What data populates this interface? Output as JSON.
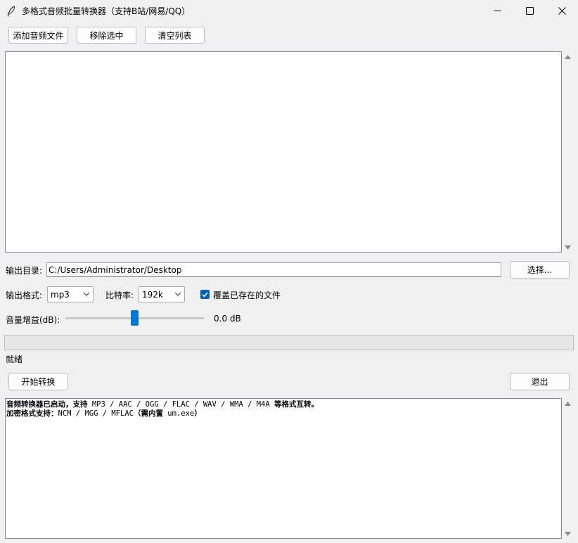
{
  "window": {
    "title": "多格式音频批量转换器（支持B站/网易/QQ）"
  },
  "toolbar": {
    "add_label": "添加音频文件",
    "remove_label": "移除选中",
    "clear_label": "清空列表"
  },
  "file_list": {
    "items": []
  },
  "output": {
    "dir_label": "输出目录:",
    "dir_value": "C:/Users/Administrator/Desktop",
    "choose_label": "选择..."
  },
  "format": {
    "label": "输出格式:",
    "value": "mp3",
    "bitrate_label": "比特率:",
    "bitrate_value": "192k",
    "overwrite_label": "覆盖已存在的文件",
    "overwrite_checked": true
  },
  "gain": {
    "label": "音量增益(dB):",
    "value_text": "0.0 dB",
    "slider_fraction": 0.5
  },
  "progress": {
    "fraction": 0
  },
  "status": {
    "text": "就绪"
  },
  "actions": {
    "start_label": "开始转换",
    "exit_label": "退出"
  },
  "log": {
    "line1_bold_a": "音频转换器已启动，支持",
    "line1_mono": " MP3 / AAC / OGG / FLAC / WAV / WMA / M4A ",
    "line1_bold_b": "等格式互转。",
    "line2_bold_a": "加密格式支持：",
    "line2_mono_a": "NCM / MGG / MFLAC",
    "line2_bold_b": "（需内置",
    "line2_mono_b": " um.exe",
    "line2_bold_c": "）"
  },
  "colors": {
    "accent": "#0078d7",
    "checkbox": "#005fb8",
    "window_bg": "#f0f0f0"
  },
  "icons": [
    "feather-app-icon",
    "minimize-icon",
    "maximize-icon",
    "close-icon",
    "chevron-down-icon",
    "checkmark-icon",
    "scroll-up-arrow-icon",
    "scroll-down-arrow-icon"
  ]
}
